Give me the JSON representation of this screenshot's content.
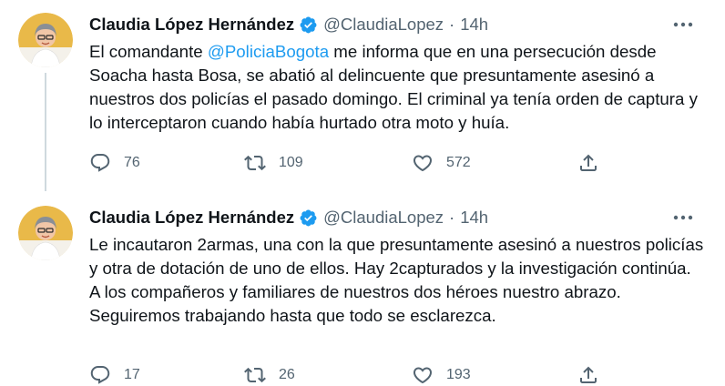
{
  "tweets": [
    {
      "author_name": "Claudia López Hernández",
      "handle": "@ClaudiaLopez",
      "separator": "·",
      "time": "14h",
      "text_before": "El comandante ",
      "mention": "@PoliciaBogota",
      "text_after": " me informa que en una persecución desde Soacha hasta Bosa, se abatió al delincuente que presuntamente asesinó a nuestros dos policías el pasado domingo. El criminal ya tenía orden de captura y lo interceptaron cuando había hurtado otra moto y huía.",
      "replies": "76",
      "retweets": "109",
      "likes": "572"
    },
    {
      "author_name": "Claudia López Hernández",
      "handle": "@ClaudiaLopez",
      "separator": "·",
      "time": "14h",
      "text": "Le incautaron 2armas, una con la que presuntamente asesinó a nuestros policías y otra de dotación de uno de ellos. Hay 2capturados y la investigación continúa.\nA los compañeros y familiares de nuestros dos héroes nuestro abrazo.\nSeguiremos trabajando hasta que todo se esclarezca.",
      "replies": "17",
      "retweets": "26",
      "likes": "193"
    }
  ],
  "colors": {
    "text": "#0f1419",
    "secondary": "#536471",
    "link": "#1d9bf0",
    "verified": "#1d9bf0",
    "thread_line": "#cfd9de"
  },
  "icons": [
    "verified-badge-icon",
    "more-options-icon",
    "reply-icon",
    "retweet-icon",
    "like-icon",
    "share-icon"
  ]
}
